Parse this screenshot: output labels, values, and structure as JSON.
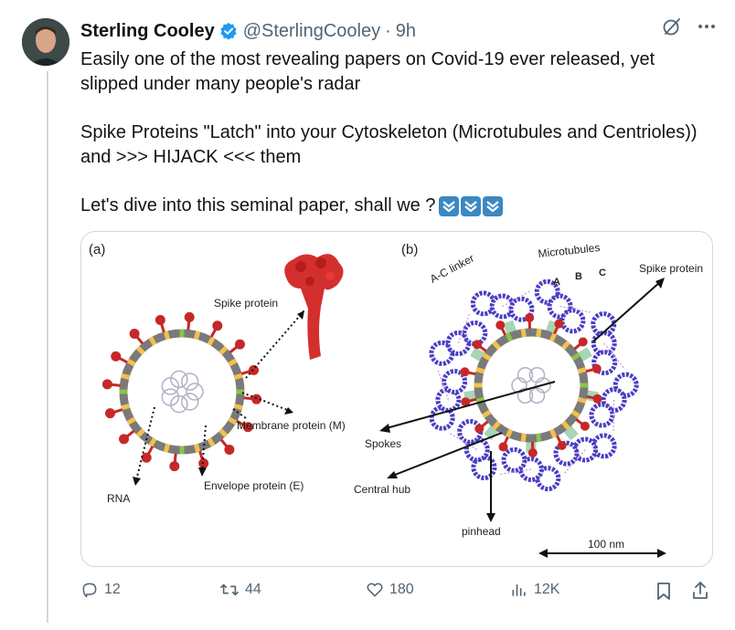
{
  "author": {
    "name": "Sterling Cooley",
    "handle": "@SterlingCooley",
    "separator": "·",
    "time": "9h"
  },
  "icons": {
    "verified": "verified-badge-icon",
    "grok": "grok-slash-icon",
    "more": "more-dots-icon",
    "emoji": "down-arrow-emoji-icon"
  },
  "tweet": {
    "line1": "Easily one of the most revealing papers on Covid-19 ever released, yet slipped under many people's radar",
    "line2": "Spike Proteins \"Latch\" into your Cytoskeleton (Microtubules and Centrioles)) and >>> HIJACK <<< them",
    "line3": "Let's dive into this seminal paper, shall we ?"
  },
  "figure": {
    "panel_a": "(a)",
    "panel_b": "(b)",
    "labels_a": {
      "spike": "Spike protein",
      "membrane": "Membrane protein (M)",
      "envelope": "Envelope protein (E)",
      "rna": "RNA"
    },
    "labels_b": {
      "microtubules": "Microtubules",
      "ac_linker": "A-C linker",
      "spike": "Spike protein",
      "a": "A",
      "b": "B",
      "c": "C",
      "spokes": "Spokes",
      "central_hub": "Central hub",
      "pinhead": "pinhead",
      "scale": "100 nm"
    }
  },
  "actions": {
    "replies": "12",
    "reposts": "44",
    "likes": "180",
    "views": "12K"
  },
  "colors": {
    "text": "#0f1419",
    "secondary": "#536471",
    "verified": "#1d9bf0",
    "spike_red": "#c62828",
    "microtubule_blue": "#4a3fc4",
    "linker_green": "#a8d5b5"
  }
}
